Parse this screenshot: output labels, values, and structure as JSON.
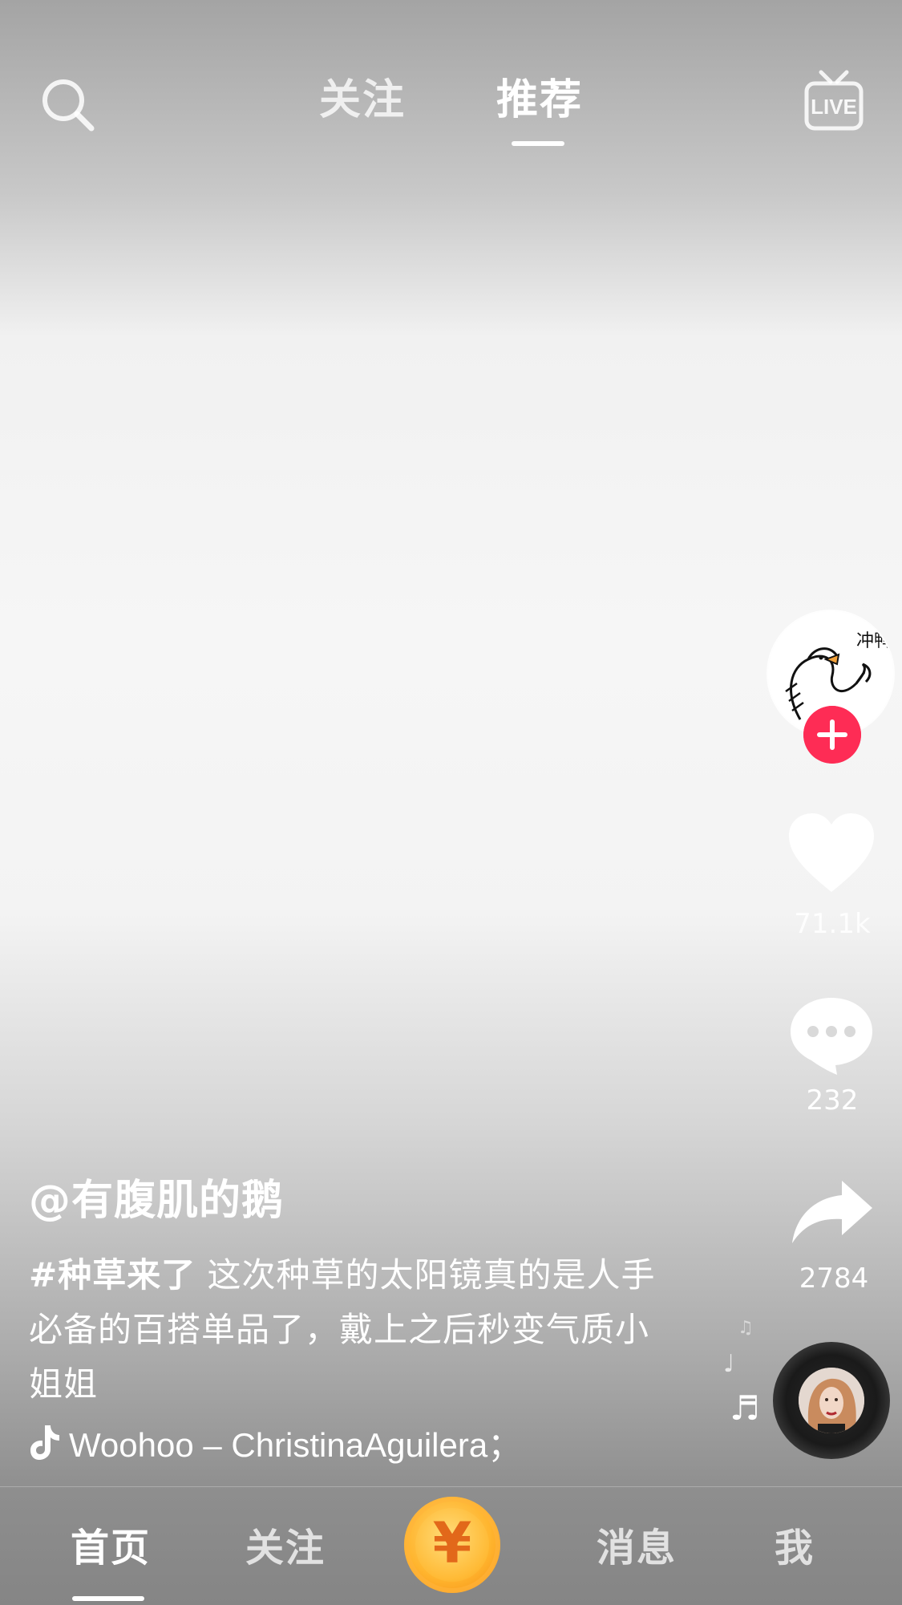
{
  "top_bar": {
    "tabs": [
      {
        "label": "关注",
        "active": false
      },
      {
        "label": "推荐",
        "active": true
      }
    ],
    "search_icon": "search-icon",
    "live_icon": "live-tv-icon",
    "live_label": "LIVE"
  },
  "creator": {
    "handle": "@有腹肌的鹅",
    "avatar_caption": "冲鸭"
  },
  "caption": {
    "hashtag": "#种草来了",
    "text": " 这次种草的太阳镜真的是人手必备的百搭单品了，戴上之后秒变气质小姐姐"
  },
  "music": {
    "title": "Woohoo – ChristinaAguilera；"
  },
  "actions": {
    "likes": "71.1k",
    "comments": "232",
    "shares": "2784"
  },
  "bottom_nav": {
    "items": [
      {
        "label": "首页",
        "active": true
      },
      {
        "label": "关注",
        "active": false
      },
      {
        "label": "消息",
        "active": false
      },
      {
        "label": "我",
        "active": false
      }
    ],
    "center_symbol": "¥"
  },
  "colors": {
    "follow_plus": "#fe2c55",
    "coin": "#ffb52e"
  }
}
